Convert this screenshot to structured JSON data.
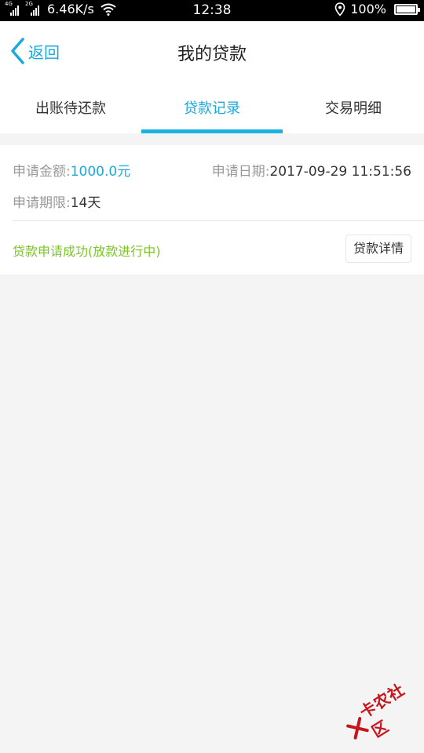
{
  "status_bar": {
    "signal1_gen": "4G",
    "signal2_gen": "2G",
    "speed": "6.46K/s",
    "time": "12:38",
    "battery": "100%"
  },
  "nav": {
    "back_label": "返回",
    "title": "我的贷款"
  },
  "tabs": [
    {
      "label": "出账待还款",
      "active": false
    },
    {
      "label": "贷款记录",
      "active": true
    },
    {
      "label": "交易明细",
      "active": false
    }
  ],
  "record": {
    "amount_label": "申请金额:",
    "amount": "1000.0元",
    "date_label": "申请日期:",
    "date": "2017-09-29 11:51:56",
    "term_label": "申请期限:",
    "term": "14天",
    "status": "贷款申请成功(放款进行中)",
    "detail_button": "贷款详情"
  },
  "watermark": {
    "text": "卡农社区"
  },
  "colors": {
    "accent": "#1aa9dc",
    "success": "#7cc628",
    "watermark": "#c8151b"
  }
}
